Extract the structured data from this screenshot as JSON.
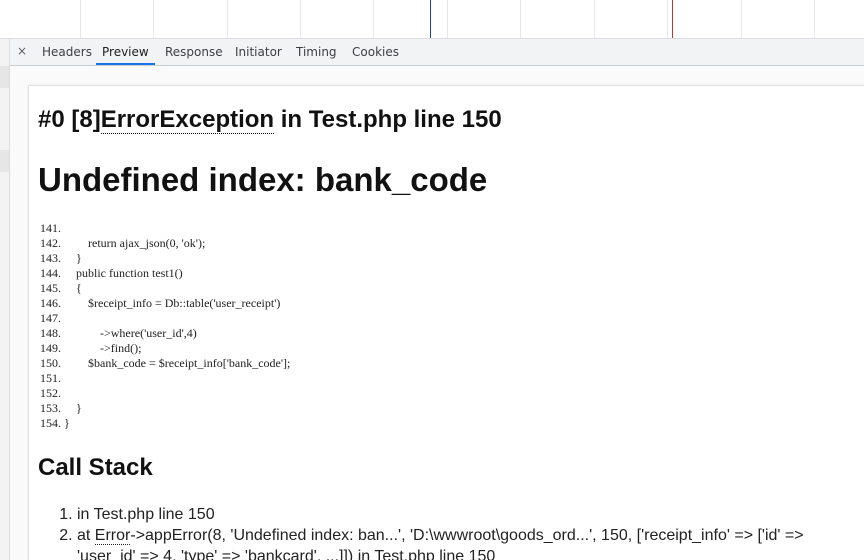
{
  "tabs": {
    "close_label": "×",
    "items": [
      "Headers",
      "Preview",
      "Response",
      "Initiator",
      "Timing",
      "Cookies"
    ],
    "active": "Preview"
  },
  "colors": {
    "accent": "#1a73e8",
    "timeline_blue": "#1a3fbf",
    "timeline_red": "#c0392b"
  },
  "error": {
    "prefix": "#0 [8]",
    "class_name": "ErrorException",
    "location": " in Test.php line 150",
    "message": "Undefined index: bank_code"
  },
  "code": [
    "141.",
    "142.         return ajax_json(0, 'ok');",
    "143.     }",
    "144.     public function test1()",
    "145.     {",
    "146.         $receipt_info = Db::table('user_receipt')",
    "147.",
    "148.             ->where('user_id',4)",
    "149.             ->find();",
    "150.         $bank_code = $receipt_info['bank_code'];",
    "151.",
    "152.",
    "153.     }",
    "154. }"
  ],
  "call_stack": {
    "title": "Call Stack",
    "item1": "in Test.php line 150",
    "item2_prefix": "at ",
    "item2_class": "Error",
    "item2_text": "->appError(8, 'Undefined index: ban...', 'D:\\wwwroot\\goods_ord...', 150, ['receipt_info' => ['id' =>",
    "item2_cont": "'user_id' => 4, 'type' => 'bankcard', ...]]) in Test.php line 150"
  }
}
